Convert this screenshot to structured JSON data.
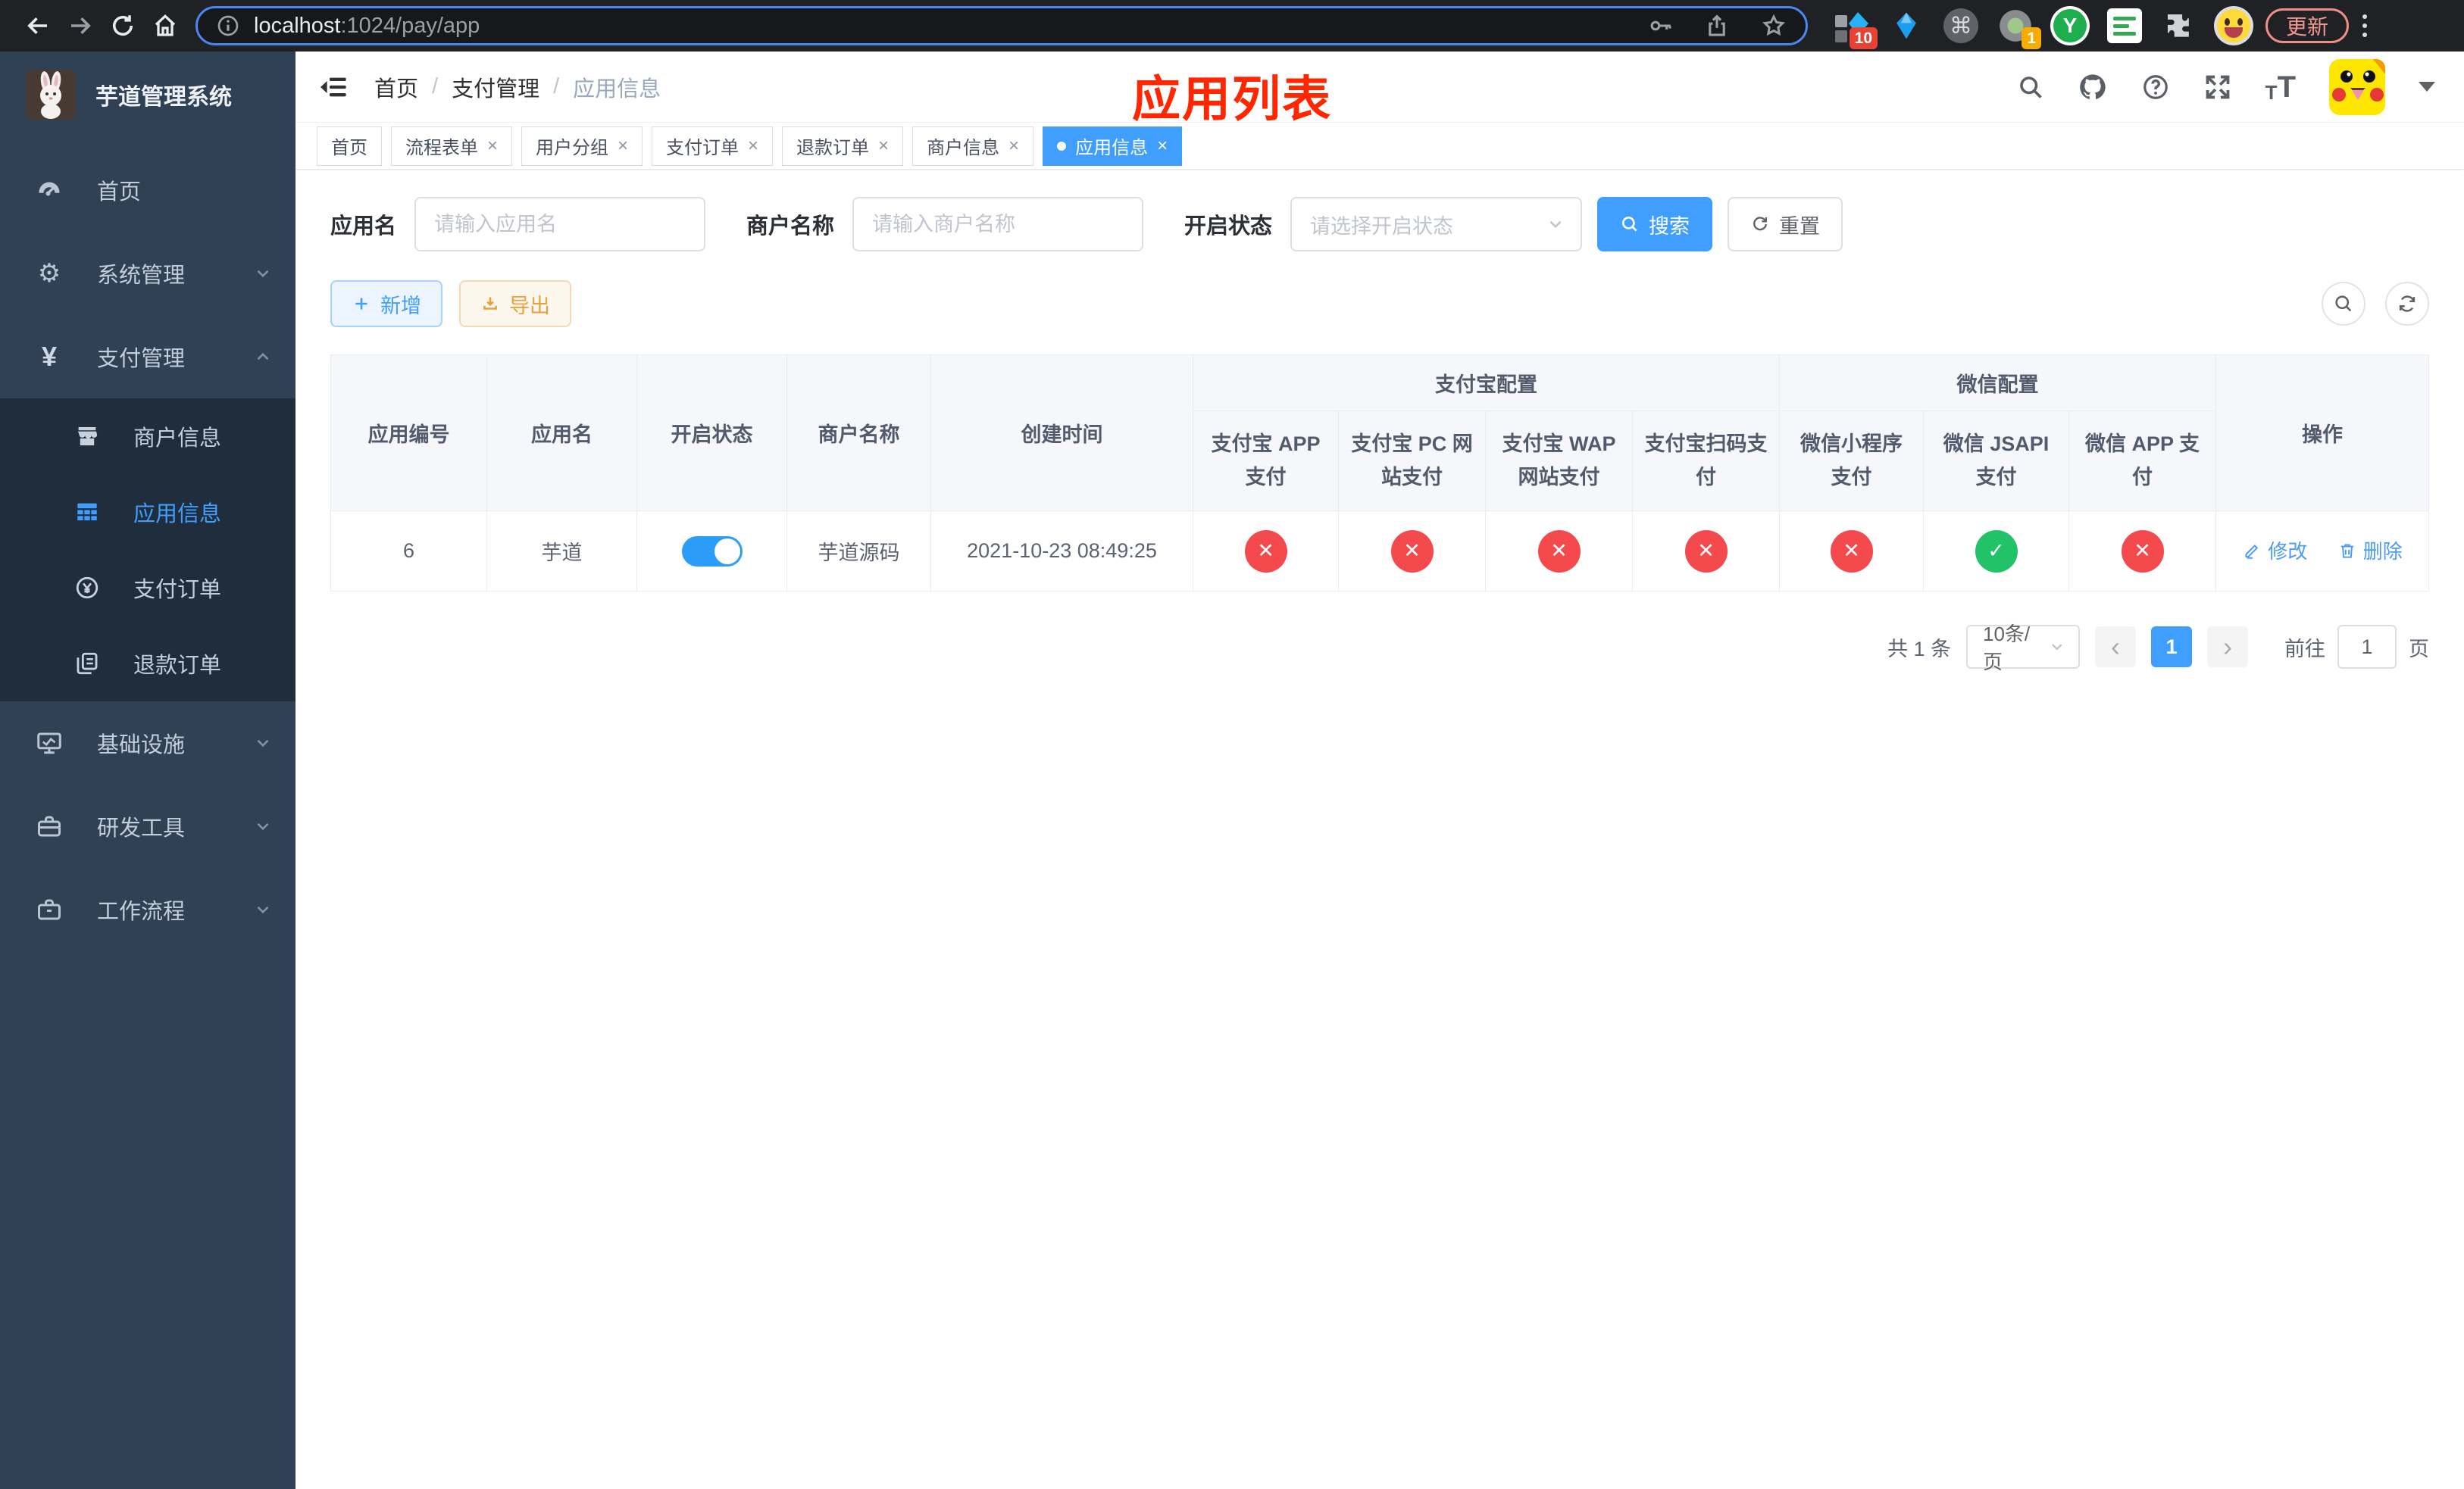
{
  "browser": {
    "url_host": "localhost",
    "url_path": ":1024/pay/app",
    "update_label": "更新",
    "ext_badge_blue_diamond": "10",
    "ext_badge_record": "1"
  },
  "sidebar": {
    "title": "芋道管理系统",
    "menu": [
      {
        "label": "首页"
      },
      {
        "label": "系统管理"
      },
      {
        "label": "支付管理"
      },
      {
        "label": "基础设施"
      },
      {
        "label": "研发工具"
      },
      {
        "label": "工作流程"
      }
    ],
    "submenu": [
      {
        "label": "商户信息"
      },
      {
        "label": "应用信息"
      },
      {
        "label": "支付订单"
      },
      {
        "label": "退款订单"
      }
    ]
  },
  "navbar": {
    "breadcrumb": [
      "首页",
      "支付管理",
      "应用信息"
    ],
    "sep": "/"
  },
  "page_title": "应用列表",
  "tabs": [
    {
      "label": "首页"
    },
    {
      "label": "流程表单"
    },
    {
      "label": "用户分组"
    },
    {
      "label": "支付订单"
    },
    {
      "label": "退款订单"
    },
    {
      "label": "商户信息"
    },
    {
      "label": "应用信息"
    }
  ],
  "icons": {
    "check": "✓",
    "cross": "✕",
    "close": "×",
    "prev": "‹",
    "next": "›",
    "command": "⌘",
    "y_logo": "Y",
    "gear": "⚙",
    "yen": "¥",
    "question": "?",
    "info": "i"
  },
  "filters": {
    "app_name_label": "应用名",
    "app_name_placeholder": "请输入应用名",
    "merchant_label": "商户名称",
    "merchant_placeholder": "请输入商户名称",
    "status_label": "开启状态",
    "status_placeholder": "请选择开启状态",
    "search_label": "搜索",
    "reset_label": "重置"
  },
  "toolbar": {
    "add_label": "新增",
    "export_label": "导出"
  },
  "table": {
    "groups": {
      "alipay": "支付宝配置",
      "wechat": "微信配置"
    },
    "columns": [
      "应用编号",
      "应用名",
      "开启状态",
      "商户名称",
      "创建时间",
      "支付宝 APP 支付",
      "支付宝 PC 网站支付",
      "支付宝 WAP 网站支付",
      "支付宝扫码支付",
      "微信小程序支付",
      "微信 JSAPI 支付",
      "微信 APP 支付",
      "操作"
    ],
    "row": {
      "id": "6",
      "name": "芋道",
      "enabled": true,
      "merchant": "芋道源码",
      "created": "2021-10-23 08:49:25",
      "pay_status": [
        false,
        false,
        false,
        false,
        false,
        true,
        false
      ],
      "edit_label": "修改",
      "delete_label": "删除"
    }
  },
  "pagination": {
    "total_label": "共 1 条",
    "page_size": "10条/页",
    "current": "1",
    "goto_label": "前往",
    "goto_value": "1",
    "page_unit": "页"
  },
  "colors": {
    "accent": "#409eff",
    "success": "#22c268",
    "danger": "#f4494d",
    "warning": "#e6a23c",
    "title_red": "#ff2600",
    "sidebar_bg": "#304156",
    "submenu_bg": "#1f2d3d"
  }
}
